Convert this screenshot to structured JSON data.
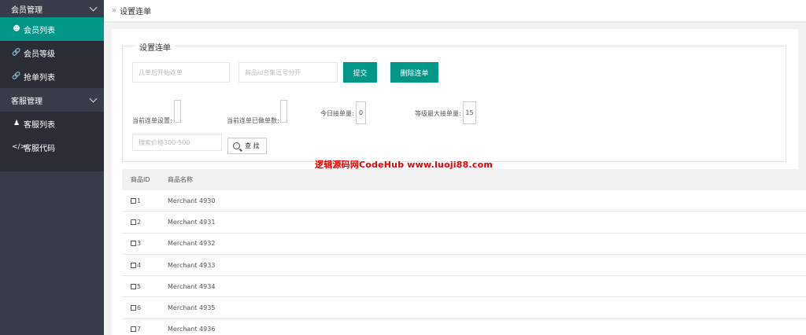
{
  "sidebar": {
    "group1": "会员管理",
    "items1": [
      {
        "label": "会员列表",
        "icon": "user-icon"
      },
      {
        "label": "会员等级",
        "icon": "link-icon"
      },
      {
        "label": "抢单列表",
        "icon": "link-icon"
      }
    ],
    "group2": "客服管理",
    "items2": [
      {
        "label": "客服列表",
        "icon": "users-icon"
      },
      {
        "label": "客服代码",
        "icon": "code-icon"
      }
    ]
  },
  "breadcrumb": {
    "separator": "»",
    "title": "设置连单"
  },
  "form": {
    "legend": "设置连单",
    "after_orders_placeholder": "几单后开始连单",
    "goods_ids_placeholder": "商品id合集逗号分开",
    "submit_label": "提交",
    "delete_label": "删除连单",
    "current_setting_label": "当前连单设置:",
    "current_setting_value": "",
    "done_count_label": "当前连单已做单数:",
    "done_count_value": "",
    "today_orders_label": "今日接单量:",
    "today_orders_value": "0",
    "max_orders_label": "等级最大接单量:",
    "max_orders_value": "15",
    "price_search_placeholder": "搜索价格300-500",
    "search_label": "查 找"
  },
  "watermark": "逻辑源码网CodeHub www.luoji88.com",
  "table": {
    "headers": [
      "商品ID",
      "商品名称"
    ],
    "rows": [
      {
        "id": "1",
        "name": "Merchant 4930"
      },
      {
        "id": "2",
        "name": "Merchant 4931"
      },
      {
        "id": "3",
        "name": "Merchant 4932"
      },
      {
        "id": "4",
        "name": "Merchant 4933"
      },
      {
        "id": "5",
        "name": "Merchant 4934"
      },
      {
        "id": "6",
        "name": "Merchant 4935"
      },
      {
        "id": "7",
        "name": "Merchant 4936"
      }
    ]
  },
  "colors": {
    "accent": "#009688",
    "sidebar": "#393d49",
    "sidebar_item": "#2a2d36",
    "watermark": "#e60000"
  }
}
